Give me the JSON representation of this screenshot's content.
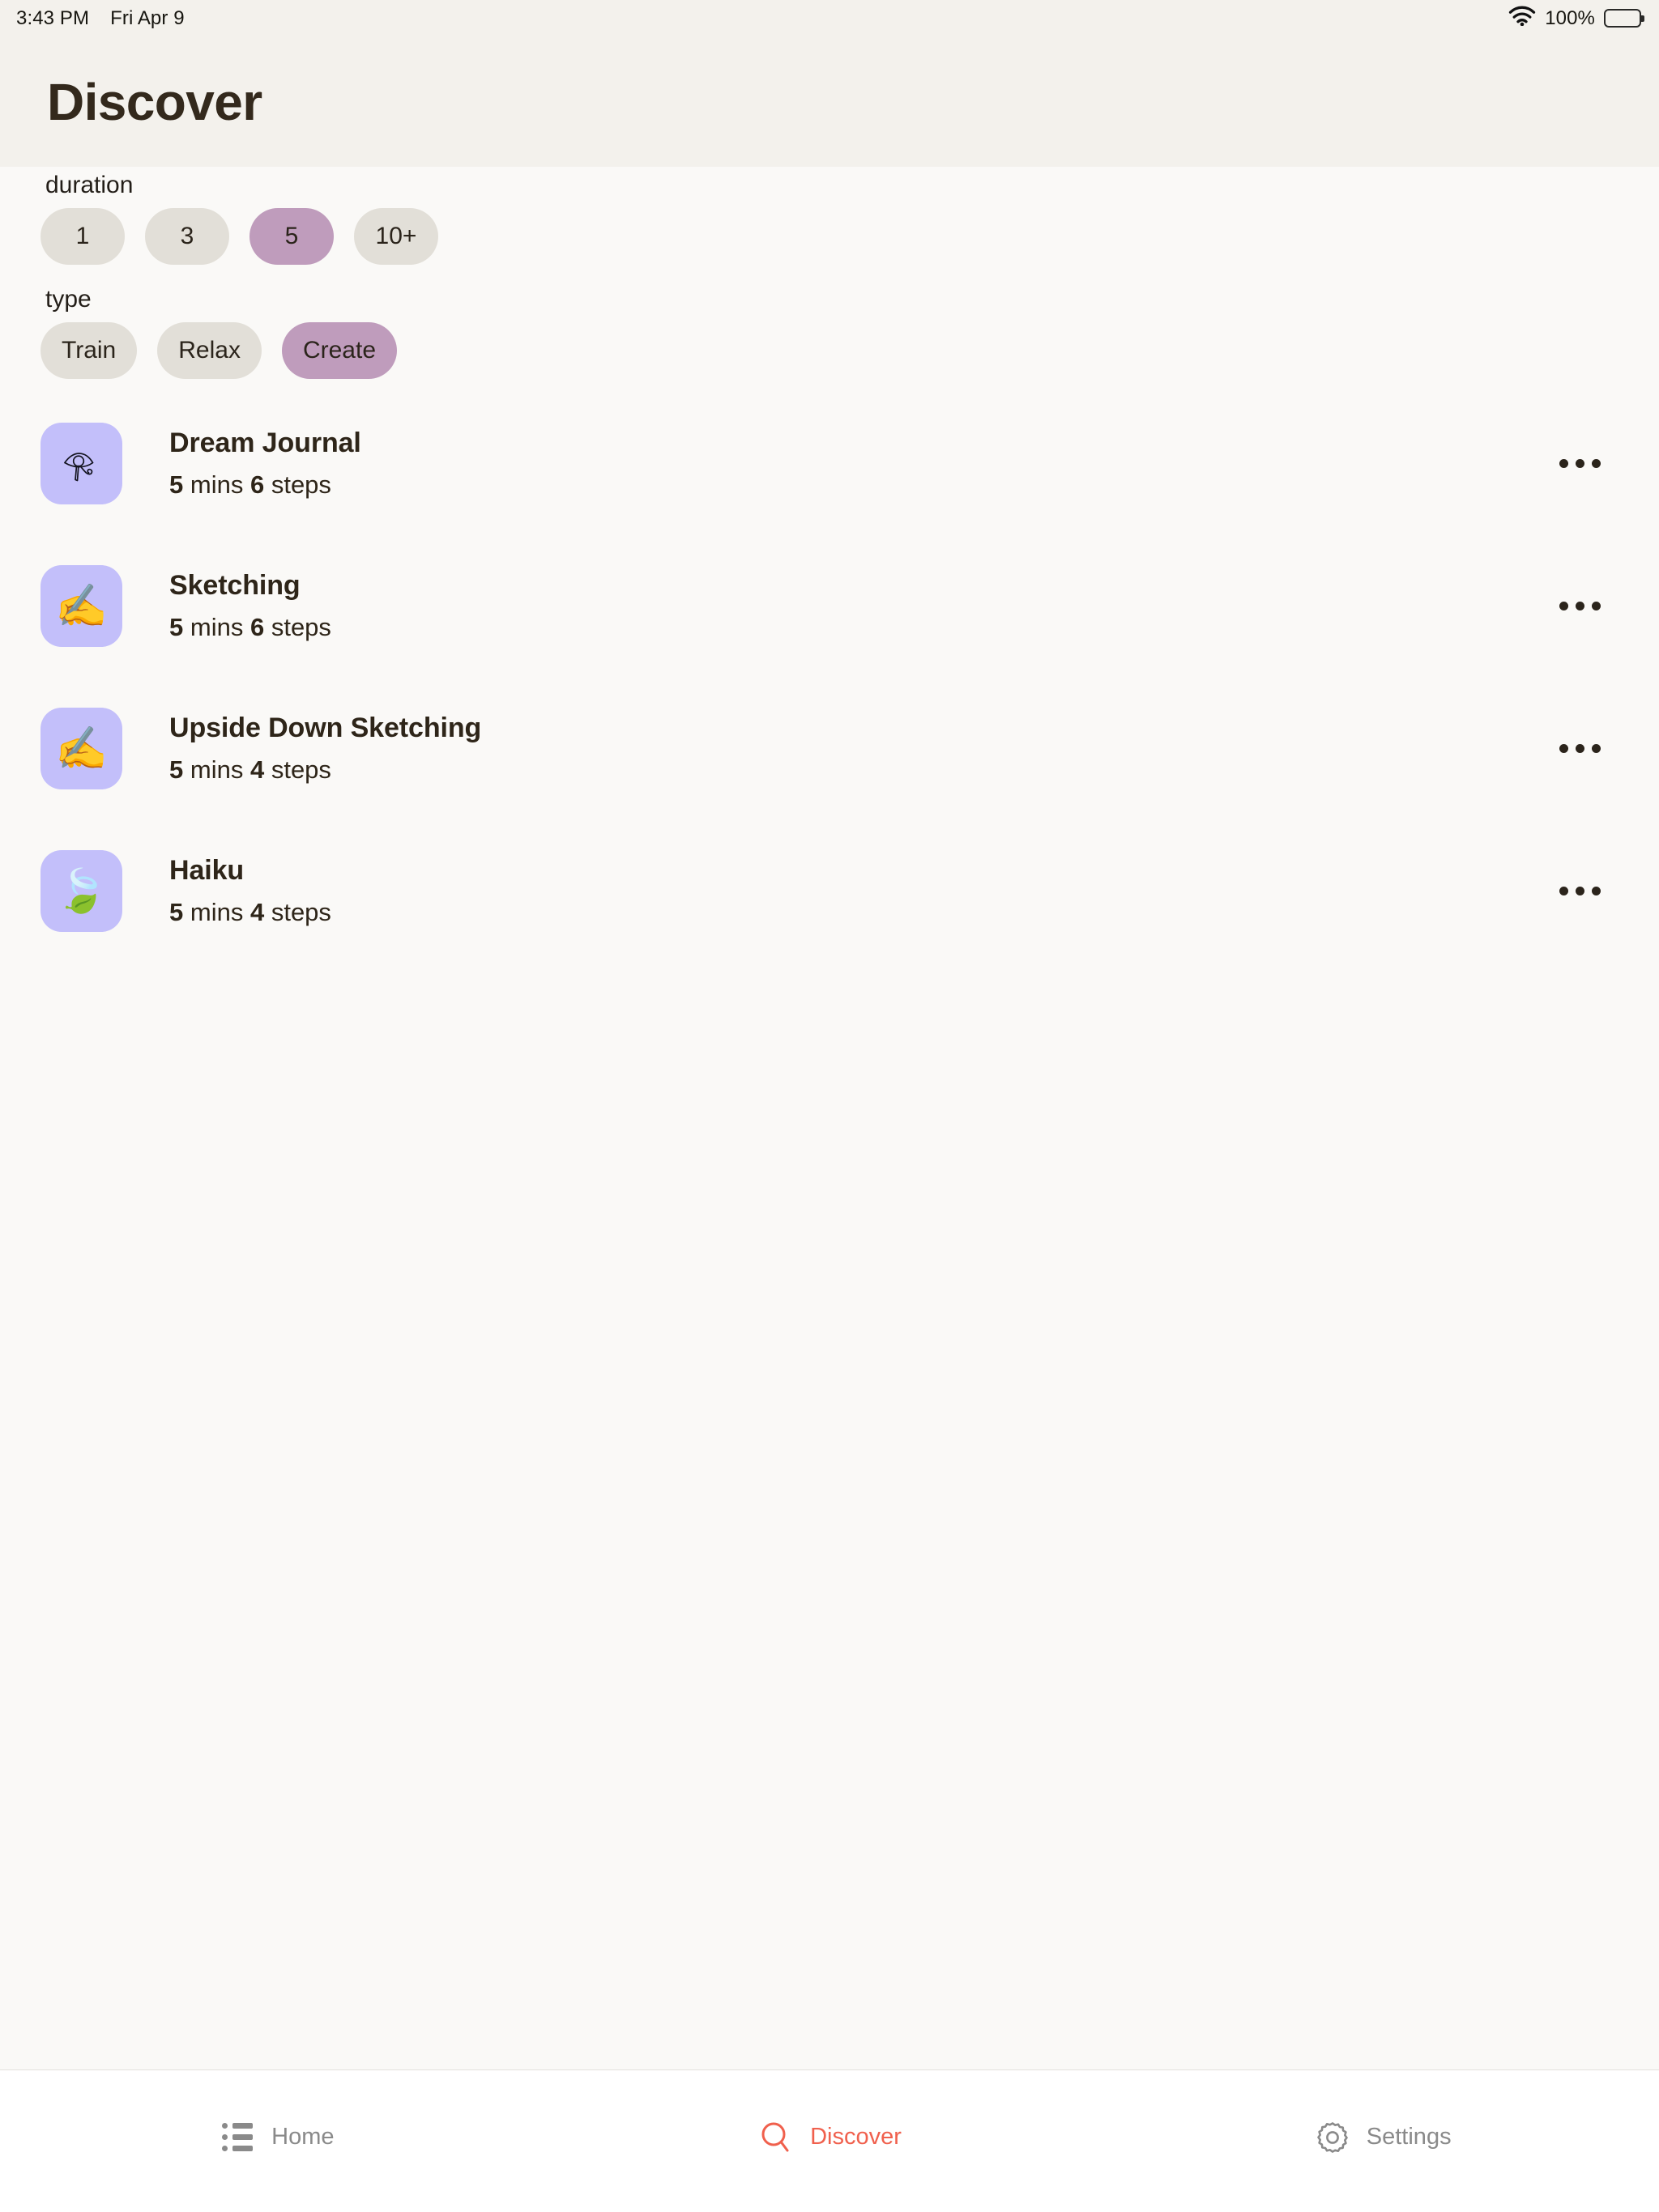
{
  "status_bar": {
    "time": "3:43 PM",
    "date": "Fri Apr 9",
    "wifi_icon": "wifi-icon",
    "battery_percent": "100%",
    "battery_icon": "battery-full-icon"
  },
  "header": {
    "title": "Discover"
  },
  "filters": [
    {
      "label": "duration",
      "name": "duration",
      "options": [
        {
          "label": "1",
          "selected": false
        },
        {
          "label": "3",
          "selected": false
        },
        {
          "label": "5",
          "selected": true
        },
        {
          "label": "10+",
          "selected": false
        }
      ]
    },
    {
      "label": "type",
      "name": "type",
      "options": [
        {
          "label": "Train",
          "selected": false
        },
        {
          "label": "Relax",
          "selected": false
        },
        {
          "label": "Create",
          "selected": true
        }
      ]
    }
  ],
  "activities": [
    {
      "name": "Dream Journal",
      "icon": "eye-of-horus-icon",
      "icon_glyph": "",
      "minutes": "5",
      "minutes_unit": "mins",
      "steps": "6",
      "steps_unit": "steps",
      "menu_icon": "more-options-icon"
    },
    {
      "name": "Sketching",
      "icon": "writing-hand-icon",
      "icon_glyph": "✍️",
      "minutes": "5",
      "minutes_unit": "mins",
      "steps": "6",
      "steps_unit": "steps",
      "menu_icon": "more-options-icon"
    },
    {
      "name": "Upside Down Sketching",
      "icon": "writing-hand-icon",
      "icon_glyph": "✍️",
      "minutes": "5",
      "minutes_unit": "mins",
      "steps": "4",
      "steps_unit": "steps",
      "menu_icon": "more-options-icon"
    },
    {
      "name": "Haiku",
      "icon": "leaf-fluttering-icon",
      "icon_glyph": "🍃",
      "minutes": "5",
      "minutes_unit": "mins",
      "steps": "4",
      "steps_unit": "steps",
      "menu_icon": "more-options-icon"
    }
  ],
  "tab_bar": [
    {
      "label": "Home",
      "icon": "list-icon",
      "active": false
    },
    {
      "label": "Discover",
      "icon": "search-icon",
      "active": true
    },
    {
      "label": "Settings",
      "icon": "gear-icon",
      "active": false
    }
  ],
  "colors": {
    "accent": "#f0604d",
    "chip_selected": "#bf9cbc",
    "chip_default": "#e2dfd8",
    "icon_tile": "#c3bffa",
    "header_bg": "#f3f1ec",
    "content_bg": "#faf9f7",
    "text": "#2e2519",
    "muted_text": "#8a8a8a"
  }
}
